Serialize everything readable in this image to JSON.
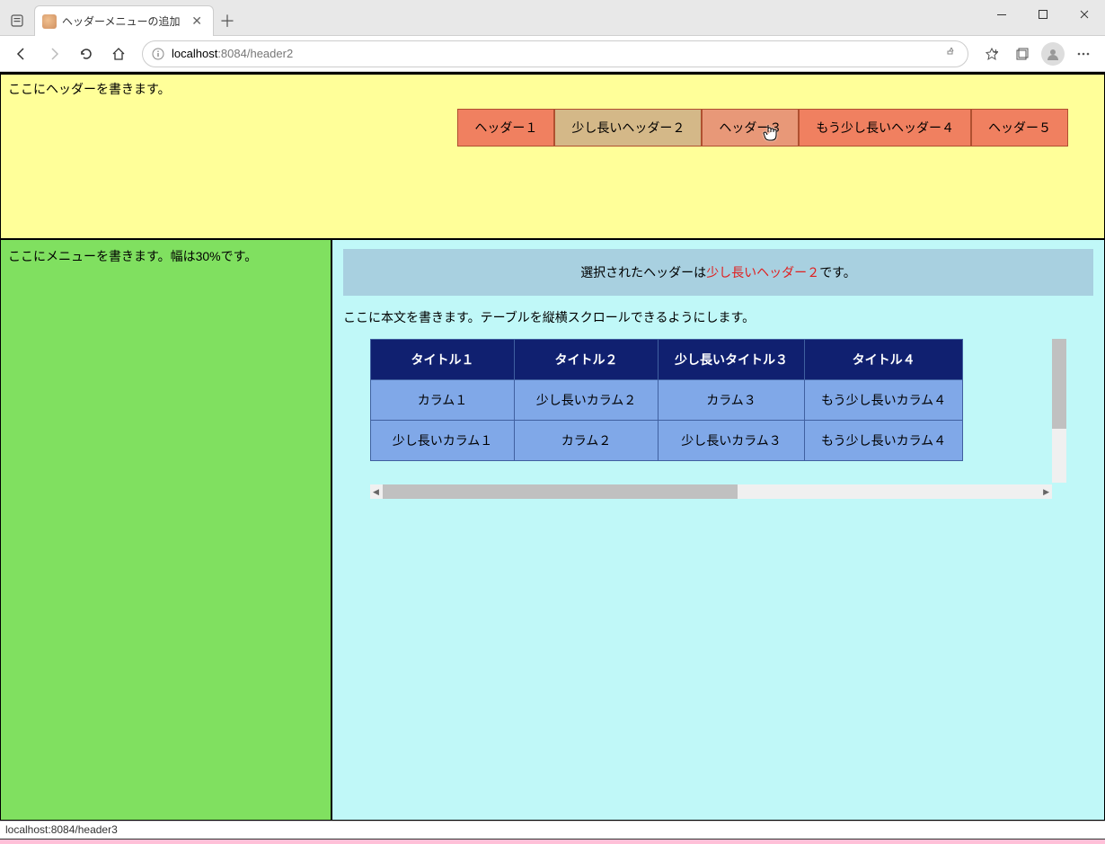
{
  "browser": {
    "tab_title": "ヘッダーメニューの追加",
    "address_prefix": "localhost",
    "address_port": ":8084",
    "address_path": "/header2"
  },
  "header": {
    "label": "ここにヘッダーを書きます。",
    "nav": [
      "ヘッダー１",
      "少し長いヘッダー２",
      "ヘッダー３",
      "もう少し長いヘッダー４",
      "ヘッダー５"
    ],
    "selected_index": 1,
    "hover_index": 2
  },
  "sidebar": {
    "label": "ここにメニューを書きます。幅は30%です。"
  },
  "main": {
    "banner_prefix": "選択されたヘッダーは",
    "banner_selected": "少し長いヘッダー２",
    "banner_suffix": "です。",
    "body_text": "ここに本文を書きます。テーブルを縦横スクロールできるようにします。",
    "table": {
      "headers": [
        "タイトル１",
        "タイトル２",
        "少し長いタイトル３",
        "タイトル４"
      ],
      "rows": [
        [
          "カラム１",
          "少し長いカラム２",
          "カラム３",
          "もう少し長いカラム４"
        ],
        [
          "少し長いカラム１",
          "カラム２",
          "少し長いカラム３",
          "もう少し長いカラム４"
        ]
      ]
    }
  },
  "statusbar": {
    "text": "localhost:8084/header3"
  }
}
